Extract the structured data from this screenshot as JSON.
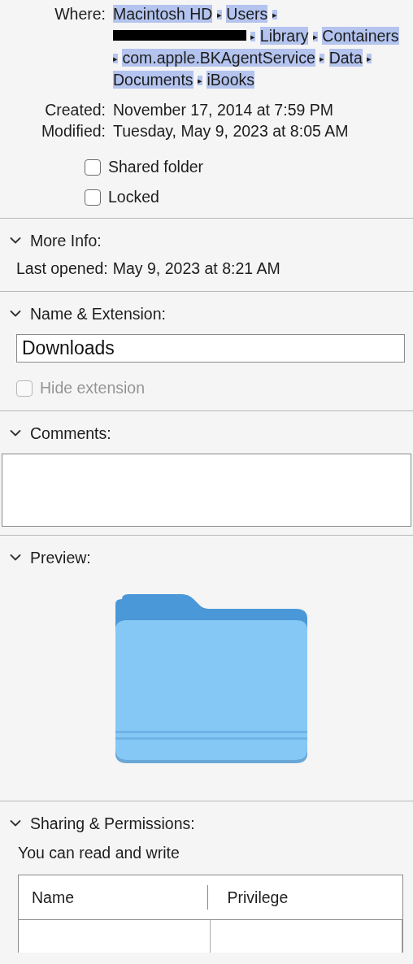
{
  "general": {
    "where": {
      "label": "Where:",
      "selected": true,
      "path": [
        {
          "kind": "text",
          "text": "Macintosh HD"
        },
        {
          "kind": "separator",
          "text": "▸"
        },
        {
          "kind": "text",
          "text": "Users"
        },
        {
          "kind": "separator",
          "text": "▸"
        },
        {
          "kind": "redacted"
        },
        {
          "kind": "separator",
          "text": "▸"
        },
        {
          "kind": "text",
          "text": "Library"
        },
        {
          "kind": "separator",
          "text": "▸"
        },
        {
          "kind": "text",
          "text": "Containers"
        },
        {
          "kind": "separator",
          "text": "▸"
        },
        {
          "kind": "text",
          "text": "com.apple.BKAgentService"
        },
        {
          "kind": "separator",
          "text": "▸"
        },
        {
          "kind": "text",
          "text": "Data"
        },
        {
          "kind": "separator",
          "text": "▸"
        },
        {
          "kind": "text",
          "text": "Documents"
        },
        {
          "kind": "separator",
          "text": "▸"
        },
        {
          "kind": "text",
          "text": "iBooks"
        }
      ]
    },
    "dates": [
      {
        "label": "Created:",
        "value": "November 17, 2014 at 7:59 PM"
      },
      {
        "label": "Modified:",
        "value": "Tuesday, May 9, 2023 at 8:05 AM"
      }
    ],
    "checkboxes": [
      {
        "label": "Shared folder",
        "checked": false,
        "disabled": false
      },
      {
        "label": "Locked",
        "checked": false,
        "disabled": false
      }
    ]
  },
  "sections": [
    {
      "kind": "more_info",
      "title": "More Info:",
      "expanded": true,
      "label": "Last opened:",
      "value": "May 9, 2023 at 8:21 AM"
    },
    {
      "kind": "name",
      "title": "Name & Extension:",
      "expanded": true,
      "value": "Downloads",
      "checkbox": {
        "label": "Hide extension",
        "checked": false,
        "disabled": true
      }
    },
    {
      "kind": "comments",
      "title": "Comments:",
      "expanded": true
    },
    {
      "kind": "preview",
      "title": "Preview:",
      "expanded": true
    },
    {
      "kind": "sharing",
      "title": "Sharing & Permissions:",
      "expanded": true,
      "summary": "You can read and write",
      "columns": [
        "Name",
        "Privilege"
      ]
    }
  ]
}
